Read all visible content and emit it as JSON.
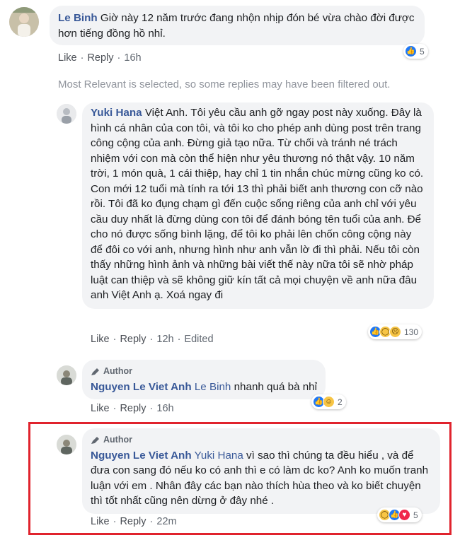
{
  "comments": [
    {
      "author": "Le Binh",
      "text": "Giờ này 12 năm trước đang nhộn nhịp đón bé vừa chào đời được hơn tiếng đồng hồ nhỉ.",
      "like_label": "Like",
      "reply_label": "Reply",
      "time": "16h",
      "reaction_count": "5"
    },
    {
      "author": "Yuki Hana",
      "text": "Việt Anh. Tôi yêu cầu anh gỡ ngay post này xuống. Đây là hình cá nhân của con tôi, và tôi ko cho phép anh dùng post trên trang công cộng của anh. Đừng giả tạo nữa. Từ chối và tránh né trách nhiệm với con mà còn thể hiện như yêu thương nó thật vậy. 10 năm trời, 1 món quà, 1 cái thiệp, hay chỉ 1 tin nhắn chúc mừng cũng ko có. Con mới 12 tuổi mà tính ra tới 13 thì phải biết anh thương con cỡ nào rồi. Tôi đã ko đụng chạm gì đến cuộc sống riêng của anh chỉ với yêu cầu duy nhất là đừng dùng con tôi để đánh bóng tên tuổi của anh. Để cho nó được sống bình lặng, để tôi ko phải lên chốn công cộng này để đôi co với anh, nhưng hình như anh vẫn lờ đi thì phải. Nếu tôi còn thấy những hình ảnh và những bài viết thế này nữa tôi sẽ nhờ pháp luật can thiệp và sẽ không giữ kín tất cả mọi chuyện về anh nữa đâu anh Việt Anh ạ. Xoá ngay đi",
      "like_label": "Like",
      "reply_label": "Reply",
      "time": "12h",
      "edited_label": "Edited",
      "reaction_count": "130"
    },
    {
      "author_tag": "Author",
      "author": "Nguyen Le Viet Anh",
      "mention": "Le Binh",
      "text": "nhanh quá bà nhỉ",
      "like_label": "Like",
      "reply_label": "Reply",
      "time": "16h",
      "reaction_count": "2"
    },
    {
      "author_tag": "Author",
      "author": "Nguyen Le Viet Anh",
      "mention": "Yuki Hana",
      "text": "vì sao thì chúng ta đều hiểu , và để đưa con sang đó nếu ko có anh thì e có làm dc ko? Anh ko muốn tranh luận với em . Nhân đây các bạn nào thích hùa theo và ko biết chuyện thì tốt nhất cũng nên dừng ở đây nhé .",
      "like_label": "Like",
      "reply_label": "Reply",
      "time": "22m",
      "reaction_count": "5"
    }
  ],
  "filter_note": "Most Relevant is selected, so some replies may have been filtered out.",
  "colors": {
    "name": "#385898",
    "bubble": "#f2f3f5",
    "highlight": "#e0232d",
    "like": "#2078f4"
  }
}
